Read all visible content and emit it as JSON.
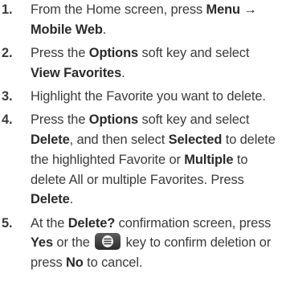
{
  "steps": [
    {
      "num": "1.",
      "parts": [
        {
          "t": "From the Home screen, press ",
          "b": false
        },
        {
          "t": "Menu → Mobile Web",
          "b": true
        },
        {
          "t": ".",
          "b": false
        }
      ]
    },
    {
      "num": "2.",
      "parts": [
        {
          "t": "Press the ",
          "b": false
        },
        {
          "t": "Options",
          "b": true
        },
        {
          "t": " soft key and select ",
          "b": false
        },
        {
          "t": "View Favorites",
          "b": true
        },
        {
          "t": ".",
          "b": false
        }
      ]
    },
    {
      "num": "3.",
      "parts": [
        {
          "t": "Highlight the Favorite you want to delete.",
          "b": false
        }
      ]
    },
    {
      "num": "4.",
      "parts": [
        {
          "t": "Press the ",
          "b": false
        },
        {
          "t": "Options",
          "b": true
        },
        {
          "t": " soft key and select ",
          "b": false
        },
        {
          "t": "Delete",
          "b": true
        },
        {
          "t": ", and then select ",
          "b": false
        },
        {
          "t": "Selected",
          "b": true
        },
        {
          "t": " to delete the highlighted Favorite or ",
          "b": false
        },
        {
          "t": "Multiple",
          "b": true
        },
        {
          "t": " to delete All or multiple Favorites. Press ",
          "b": false
        },
        {
          "t": "Delete",
          "b": true
        },
        {
          "t": ".",
          "b": false
        }
      ]
    },
    {
      "num": "5.",
      "parts": [
        {
          "t": "At the ",
          "b": false
        },
        {
          "t": "Delete?",
          "b": true
        },
        {
          "t": " confirmation screen, press ",
          "b": false
        },
        {
          "t": "Yes",
          "b": true
        },
        {
          "t": " or the ",
          "b": false
        },
        {
          "icon": "ok-key-icon"
        },
        {
          "t": " key to confirm deletion or press ",
          "b": false
        },
        {
          "t": "No",
          "b": true
        },
        {
          "t": " to cancel.",
          "b": false
        }
      ]
    }
  ]
}
